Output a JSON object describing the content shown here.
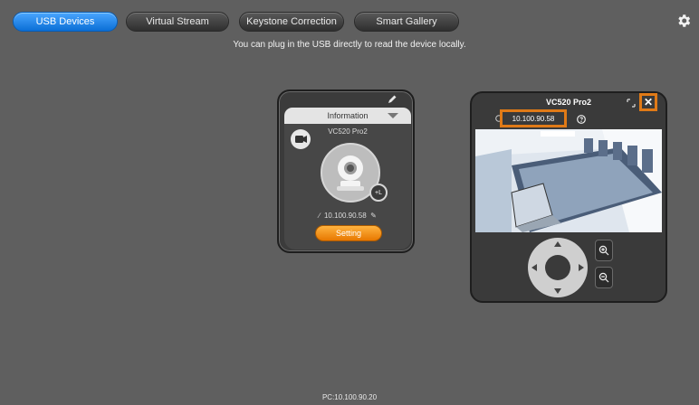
{
  "tabs": [
    {
      "label": "USB Devices",
      "active": true
    },
    {
      "label": "Virtual Stream",
      "active": false
    },
    {
      "label": "Keystone Correction",
      "active": false
    },
    {
      "label": "Smart Gallery",
      "active": false
    }
  ],
  "hint": "You can plug in the USB directly to read the device locally.",
  "info_card": {
    "tab_label": "Information",
    "device_name": "VC520 Pro2",
    "ip": "10.100.90.58",
    "setting_label": "Setting",
    "net_badge": "+L"
  },
  "preview": {
    "title": "VC520 Pro2",
    "ip": "10.100.90.58",
    "close_symbol": "✕"
  },
  "footer": "PC:10.100.90.20",
  "colors": {
    "accent_blue": "#1a86f0",
    "accent_orange": "#f08a10",
    "highlight_orange": "#e07a17",
    "background": "#5f5f5f"
  }
}
